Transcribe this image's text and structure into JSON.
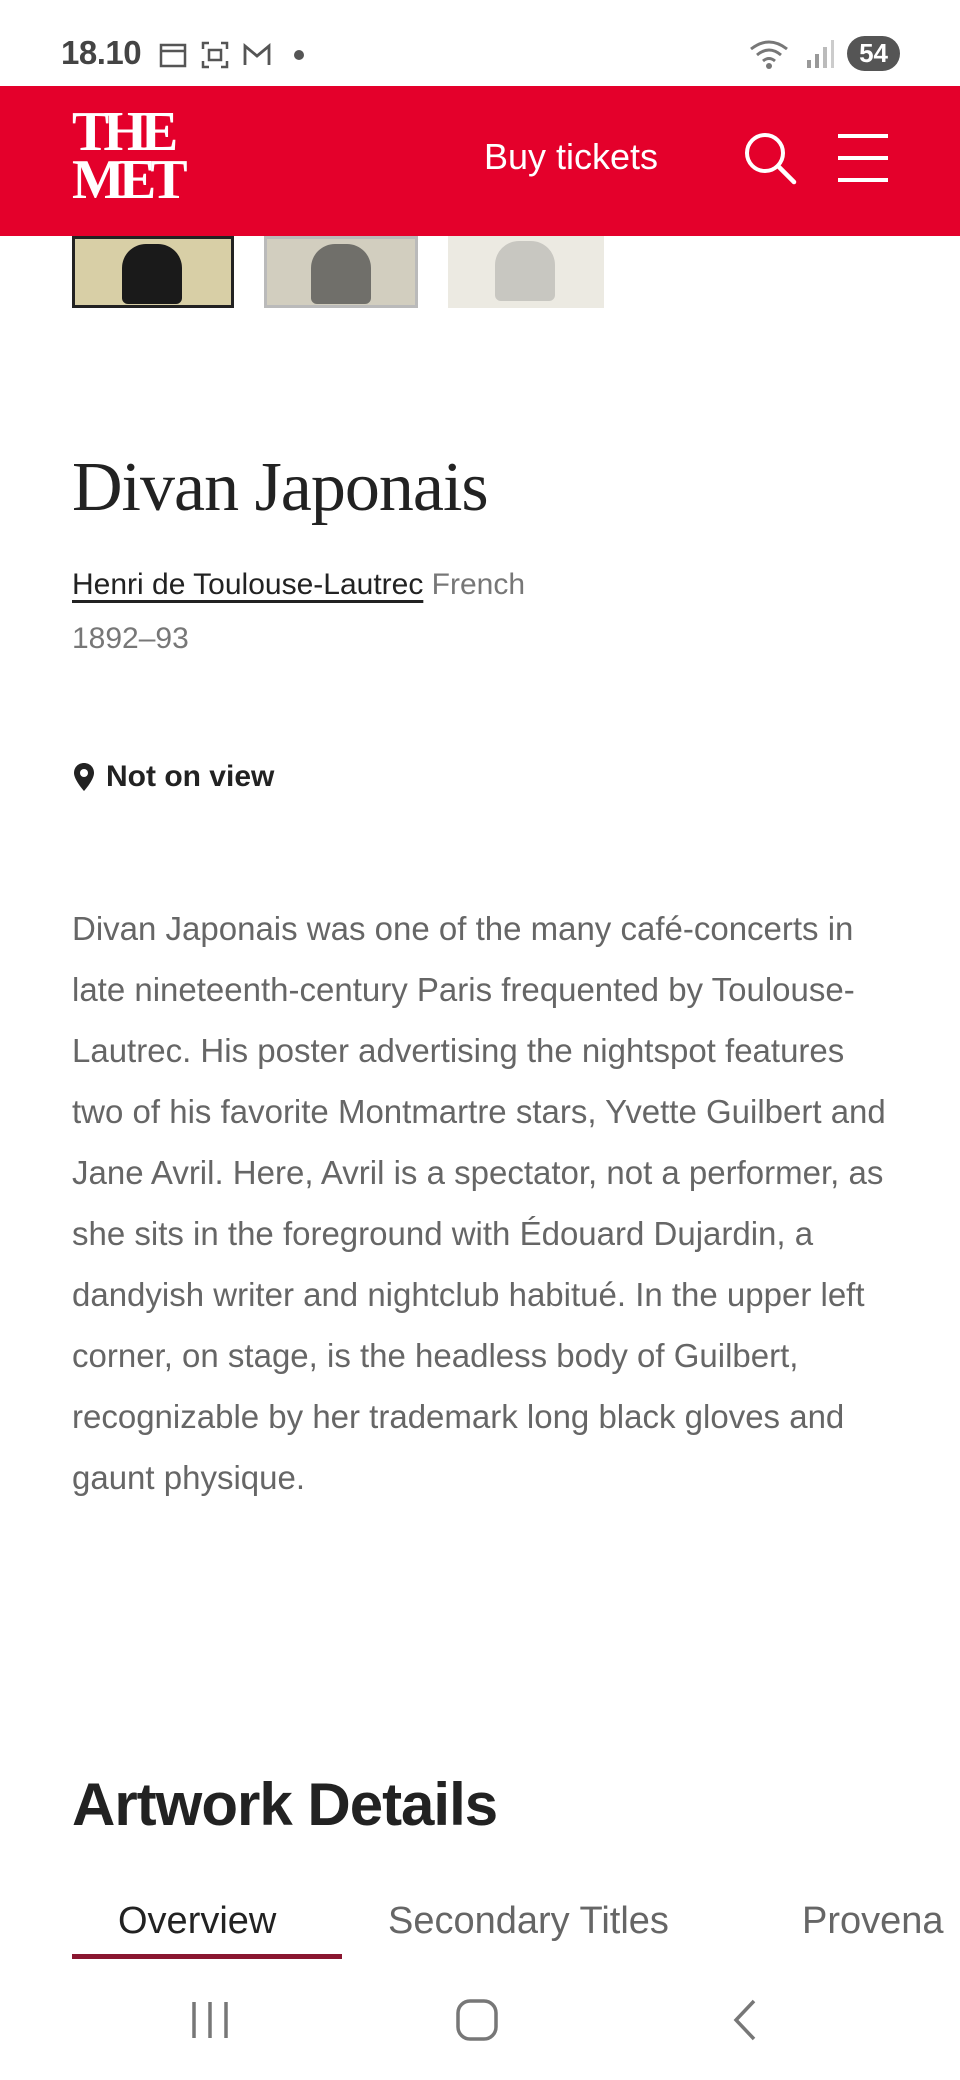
{
  "status_bar": {
    "time": "18.10",
    "battery": "54",
    "icons_left": [
      "calendar-icon",
      "screenshot-icon",
      "gmail-icon",
      "dot-icon"
    ],
    "icons_right": [
      "wifi-icon",
      "signal-icon"
    ]
  },
  "header": {
    "logo_line1": "THE",
    "logo_line2": "MET",
    "buy_tickets": "Buy tickets",
    "search_icon": "search-icon",
    "menu_icon": "hamburger-menu-icon",
    "brand_color": "#e4002b"
  },
  "artwork": {
    "title": "Divan Japonais",
    "artist": "Henri de Toulouse-Lautrec",
    "nationality": "French",
    "date": "1892–93",
    "view_status": "Not on view",
    "description": "Divan Japonais was one of the many café-concerts in late nineteenth-century Paris frequented by Toulouse-Lautrec. His poster advertising the nightspot features two of his favorite Montmartre stars, Yvette Guilbert and Jane Avril. Here, Avril is a spectator, not a performer, as she sits in the foreground with Édouard Dujardin, a dandyish writer and nightclub habitué. In the upper left corner, on stage, is the headless body of Guilbert, recognizable by her trademark long black gloves and gaunt physique."
  },
  "details": {
    "heading": "Artwork Details",
    "tabs": [
      {
        "label": "Overview",
        "active": true
      },
      {
        "label": "Secondary Titles",
        "active": false
      },
      {
        "label": "Provena",
        "active": false
      }
    ],
    "active_tab_color": "#8a1630"
  },
  "nav_bar": {
    "icons": [
      "recents-icon",
      "home-icon",
      "back-icon"
    ]
  }
}
